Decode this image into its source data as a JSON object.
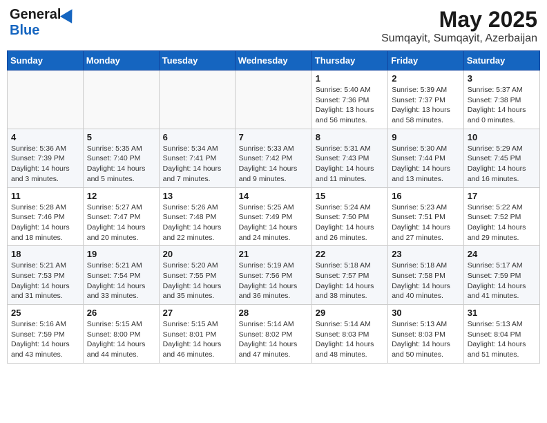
{
  "header": {
    "logo_general": "General",
    "logo_blue": "Blue",
    "month": "May 2025",
    "location": "Sumqayit, Sumqayit, Azerbaijan"
  },
  "weekdays": [
    "Sunday",
    "Monday",
    "Tuesday",
    "Wednesday",
    "Thursday",
    "Friday",
    "Saturday"
  ],
  "weeks": [
    [
      {
        "day": "",
        "info": ""
      },
      {
        "day": "",
        "info": ""
      },
      {
        "day": "",
        "info": ""
      },
      {
        "day": "",
        "info": ""
      },
      {
        "day": "1",
        "info": "Sunrise: 5:40 AM\nSunset: 7:36 PM\nDaylight: 13 hours\nand 56 minutes."
      },
      {
        "day": "2",
        "info": "Sunrise: 5:39 AM\nSunset: 7:37 PM\nDaylight: 13 hours\nand 58 minutes."
      },
      {
        "day": "3",
        "info": "Sunrise: 5:37 AM\nSunset: 7:38 PM\nDaylight: 14 hours\nand 0 minutes."
      }
    ],
    [
      {
        "day": "4",
        "info": "Sunrise: 5:36 AM\nSunset: 7:39 PM\nDaylight: 14 hours\nand 3 minutes."
      },
      {
        "day": "5",
        "info": "Sunrise: 5:35 AM\nSunset: 7:40 PM\nDaylight: 14 hours\nand 5 minutes."
      },
      {
        "day": "6",
        "info": "Sunrise: 5:34 AM\nSunset: 7:41 PM\nDaylight: 14 hours\nand 7 minutes."
      },
      {
        "day": "7",
        "info": "Sunrise: 5:33 AM\nSunset: 7:42 PM\nDaylight: 14 hours\nand 9 minutes."
      },
      {
        "day": "8",
        "info": "Sunrise: 5:31 AM\nSunset: 7:43 PM\nDaylight: 14 hours\nand 11 minutes."
      },
      {
        "day": "9",
        "info": "Sunrise: 5:30 AM\nSunset: 7:44 PM\nDaylight: 14 hours\nand 13 minutes."
      },
      {
        "day": "10",
        "info": "Sunrise: 5:29 AM\nSunset: 7:45 PM\nDaylight: 14 hours\nand 16 minutes."
      }
    ],
    [
      {
        "day": "11",
        "info": "Sunrise: 5:28 AM\nSunset: 7:46 PM\nDaylight: 14 hours\nand 18 minutes."
      },
      {
        "day": "12",
        "info": "Sunrise: 5:27 AM\nSunset: 7:47 PM\nDaylight: 14 hours\nand 20 minutes."
      },
      {
        "day": "13",
        "info": "Sunrise: 5:26 AM\nSunset: 7:48 PM\nDaylight: 14 hours\nand 22 minutes."
      },
      {
        "day": "14",
        "info": "Sunrise: 5:25 AM\nSunset: 7:49 PM\nDaylight: 14 hours\nand 24 minutes."
      },
      {
        "day": "15",
        "info": "Sunrise: 5:24 AM\nSunset: 7:50 PM\nDaylight: 14 hours\nand 26 minutes."
      },
      {
        "day": "16",
        "info": "Sunrise: 5:23 AM\nSunset: 7:51 PM\nDaylight: 14 hours\nand 27 minutes."
      },
      {
        "day": "17",
        "info": "Sunrise: 5:22 AM\nSunset: 7:52 PM\nDaylight: 14 hours\nand 29 minutes."
      }
    ],
    [
      {
        "day": "18",
        "info": "Sunrise: 5:21 AM\nSunset: 7:53 PM\nDaylight: 14 hours\nand 31 minutes."
      },
      {
        "day": "19",
        "info": "Sunrise: 5:21 AM\nSunset: 7:54 PM\nDaylight: 14 hours\nand 33 minutes."
      },
      {
        "day": "20",
        "info": "Sunrise: 5:20 AM\nSunset: 7:55 PM\nDaylight: 14 hours\nand 35 minutes."
      },
      {
        "day": "21",
        "info": "Sunrise: 5:19 AM\nSunset: 7:56 PM\nDaylight: 14 hours\nand 36 minutes."
      },
      {
        "day": "22",
        "info": "Sunrise: 5:18 AM\nSunset: 7:57 PM\nDaylight: 14 hours\nand 38 minutes."
      },
      {
        "day": "23",
        "info": "Sunrise: 5:18 AM\nSunset: 7:58 PM\nDaylight: 14 hours\nand 40 minutes."
      },
      {
        "day": "24",
        "info": "Sunrise: 5:17 AM\nSunset: 7:59 PM\nDaylight: 14 hours\nand 41 minutes."
      }
    ],
    [
      {
        "day": "25",
        "info": "Sunrise: 5:16 AM\nSunset: 7:59 PM\nDaylight: 14 hours\nand 43 minutes."
      },
      {
        "day": "26",
        "info": "Sunrise: 5:15 AM\nSunset: 8:00 PM\nDaylight: 14 hours\nand 44 minutes."
      },
      {
        "day": "27",
        "info": "Sunrise: 5:15 AM\nSunset: 8:01 PM\nDaylight: 14 hours\nand 46 minutes."
      },
      {
        "day": "28",
        "info": "Sunrise: 5:14 AM\nSunset: 8:02 PM\nDaylight: 14 hours\nand 47 minutes."
      },
      {
        "day": "29",
        "info": "Sunrise: 5:14 AM\nSunset: 8:03 PM\nDaylight: 14 hours\nand 48 minutes."
      },
      {
        "day": "30",
        "info": "Sunrise: 5:13 AM\nSunset: 8:03 PM\nDaylight: 14 hours\nand 50 minutes."
      },
      {
        "day": "31",
        "info": "Sunrise: 5:13 AM\nSunset: 8:04 PM\nDaylight: 14 hours\nand 51 minutes."
      }
    ]
  ]
}
